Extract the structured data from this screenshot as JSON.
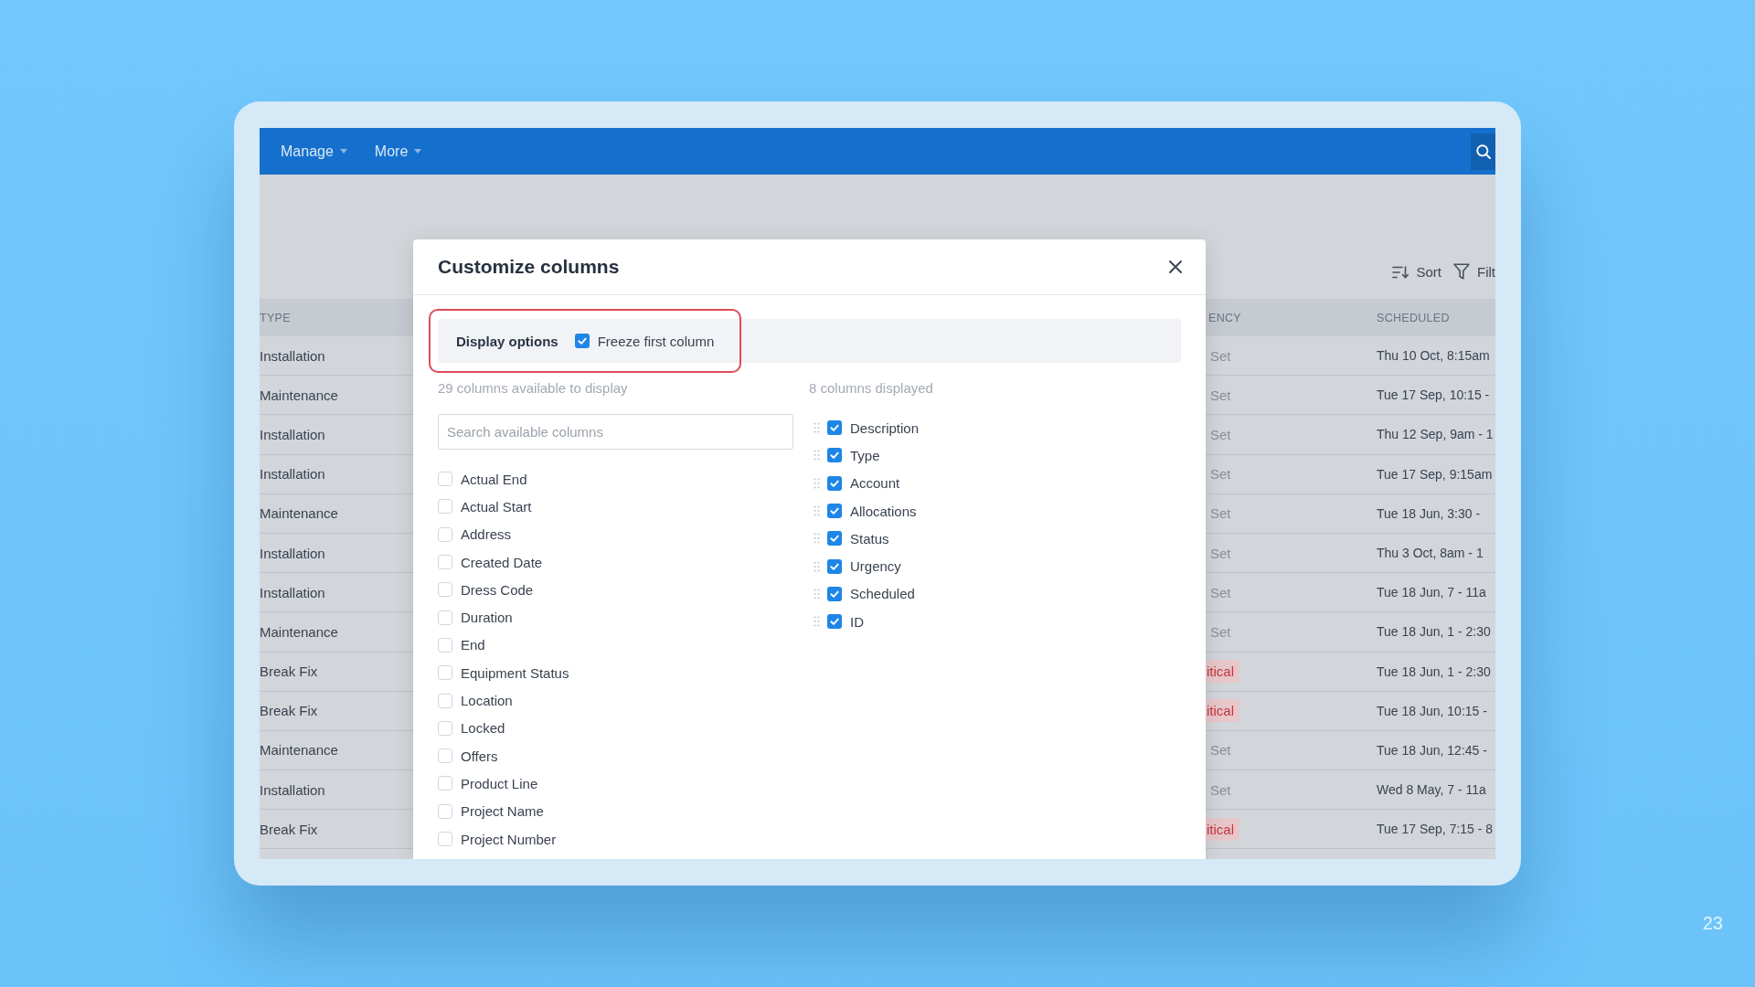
{
  "nav": {
    "menus": [
      {
        "label": "Manage"
      },
      {
        "label": "More"
      }
    ]
  },
  "toolbar": {
    "actions": [
      {
        "label": "Sort",
        "kind": "sort"
      },
      {
        "label": "Filt",
        "kind": "filter"
      }
    ]
  },
  "table": {
    "columns": [
      {
        "label": "TYPE"
      },
      {
        "label": "ENCY"
      },
      {
        "label": "SCHEDULED"
      }
    ],
    "rows": [
      {
        "type": "Installation",
        "urgency": {
          "text": "Set",
          "kind": "plain"
        },
        "scheduled": "Thu 10 Oct, 8:15am"
      },
      {
        "type": "Maintenance",
        "urgency": {
          "text": "Set",
          "kind": "plain"
        },
        "scheduled": "Tue 17 Sep, 10:15 -"
      },
      {
        "type": "Installation",
        "urgency": {
          "text": "Set",
          "kind": "plain"
        },
        "scheduled": "Thu 12 Sep, 9am - 1"
      },
      {
        "type": "Installation",
        "urgency": {
          "text": "Set",
          "kind": "plain"
        },
        "scheduled": "Tue 17 Sep, 9:15am"
      },
      {
        "type": "Maintenance",
        "urgency": {
          "text": "Set",
          "kind": "plain"
        },
        "scheduled": "Tue 18 Jun, 3:30 -"
      },
      {
        "type": "Installation",
        "urgency": {
          "text": "Set",
          "kind": "plain"
        },
        "scheduled": "Thu 3 Oct, 8am - 1"
      },
      {
        "type": "Installation",
        "urgency": {
          "text": "Set",
          "kind": "plain"
        },
        "scheduled": "Tue 18 Jun, 7 - 11a"
      },
      {
        "type": "Maintenance",
        "urgency": {
          "text": "Set",
          "kind": "plain"
        },
        "scheduled": "Tue 18 Jun, 1 - 2:30"
      },
      {
        "type": "Break Fix",
        "urgency": {
          "text": "itical",
          "kind": "badge"
        },
        "scheduled": "Tue 18 Jun, 1 - 2:30"
      },
      {
        "type": "Break Fix",
        "urgency": {
          "text": "itical",
          "kind": "badge"
        },
        "scheduled": "Tue 18 Jun, 10:15 -"
      },
      {
        "type": "Maintenance",
        "urgency": {
          "text": "Set",
          "kind": "plain"
        },
        "scheduled": "Tue 18 Jun, 12:45 -"
      },
      {
        "type": "Installation",
        "urgency": {
          "text": "Set",
          "kind": "plain"
        },
        "scheduled": "Wed 8 May, 7 - 11a"
      },
      {
        "type": "Break Fix",
        "urgency": {
          "text": "itical",
          "kind": "badge"
        },
        "scheduled": "Tue 17 Sep, 7:15 - 8"
      }
    ]
  },
  "modal": {
    "title": "Customize columns",
    "display_options": {
      "label": "Display options",
      "highlighted": true,
      "option": {
        "label": "Freeze first column",
        "checked": true
      }
    },
    "available": {
      "caption": "29 columns available to display",
      "search": {
        "placeholder": "Search available columns"
      },
      "items": [
        {
          "label": "Actual End",
          "checked": false
        },
        {
          "label": "Actual Start",
          "checked": false
        },
        {
          "label": "Address",
          "checked": false
        },
        {
          "label": "Created Date",
          "checked": false
        },
        {
          "label": "Dress Code",
          "checked": false
        },
        {
          "label": "Duration",
          "checked": false
        },
        {
          "label": "End",
          "checked": false
        },
        {
          "label": "Equipment Status",
          "checked": false
        },
        {
          "label": "Location",
          "checked": false
        },
        {
          "label": "Locked",
          "checked": false
        },
        {
          "label": "Offers",
          "checked": false
        },
        {
          "label": "Product Line",
          "checked": false
        },
        {
          "label": "Project Name",
          "checked": false
        },
        {
          "label": "Project Number",
          "checked": false
        }
      ]
    },
    "displayed": {
      "caption": "8 columns displayed",
      "items": [
        {
          "label": "Description",
          "checked": true
        },
        {
          "label": "Type",
          "checked": true
        },
        {
          "label": "Account",
          "checked": true
        },
        {
          "label": "Allocations",
          "checked": true
        },
        {
          "label": "Status",
          "checked": true
        },
        {
          "label": "Urgency",
          "checked": true
        },
        {
          "label": "Scheduled",
          "checked": true
        },
        {
          "label": "ID",
          "checked": true
        }
      ]
    }
  },
  "slide": {
    "page_number": "23"
  }
}
